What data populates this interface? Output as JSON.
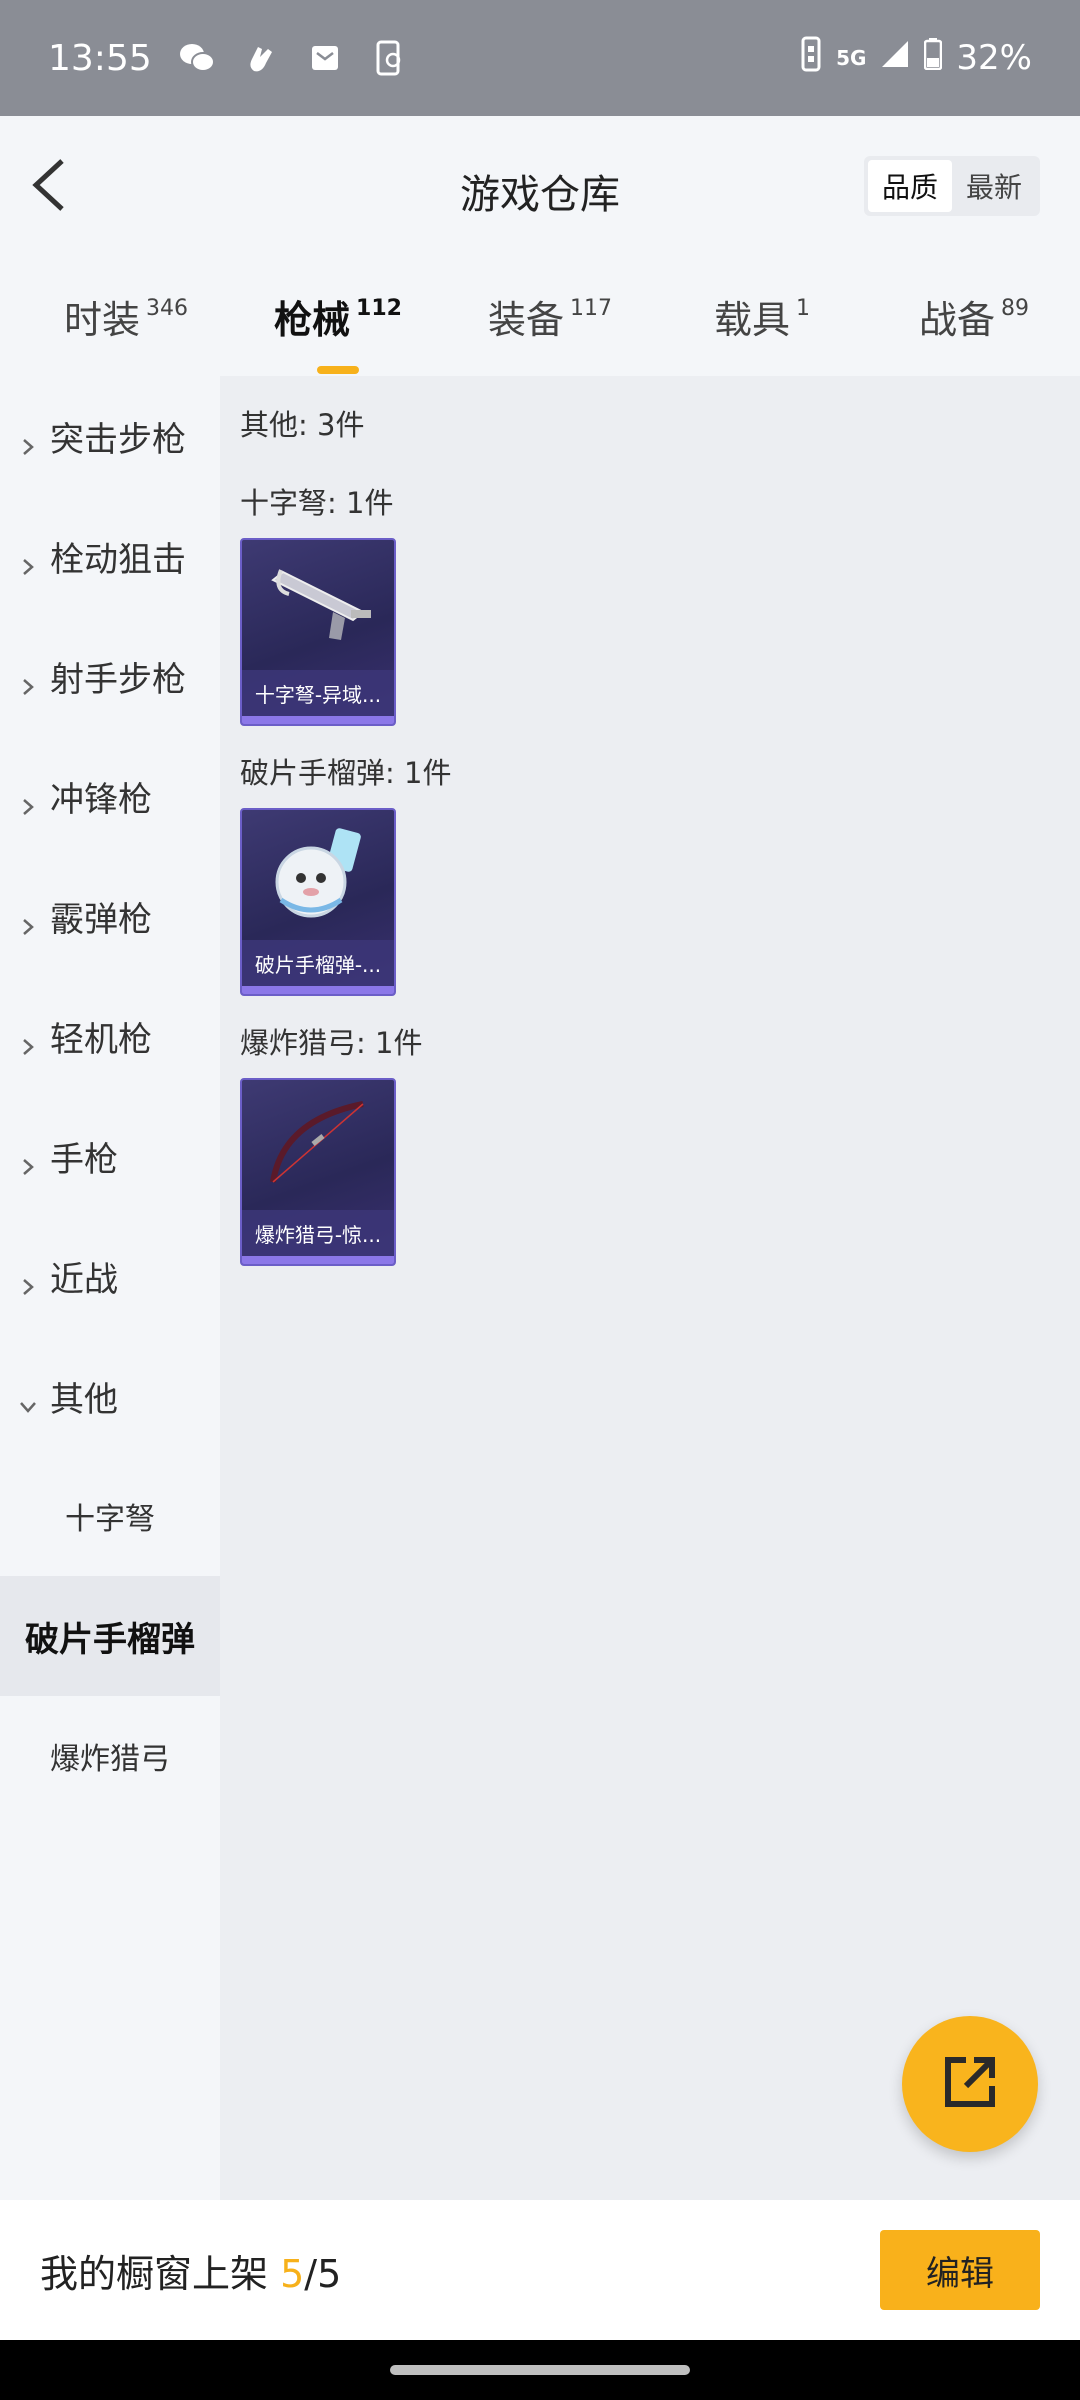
{
  "status_bar": {
    "time": "13:55",
    "network": "5G",
    "battery": "32%"
  },
  "header": {
    "title": "游戏仓库",
    "sort_options": [
      {
        "label": "品质",
        "active": true
      },
      {
        "label": "最新",
        "active": false
      }
    ]
  },
  "tabs": [
    {
      "label": "时装",
      "count": "346",
      "active": false
    },
    {
      "label": "枪械",
      "count": "112",
      "active": true
    },
    {
      "label": "装备",
      "count": "117",
      "active": false
    },
    {
      "label": "载具",
      "count": "1",
      "active": false
    },
    {
      "label": "战备",
      "count": "89",
      "active": false
    }
  ],
  "sidebar": {
    "items": [
      {
        "label": "突击步枪",
        "expanded": false
      },
      {
        "label": "栓动狙击",
        "expanded": false
      },
      {
        "label": "射手步枪",
        "expanded": false
      },
      {
        "label": "冲锋枪",
        "expanded": false
      },
      {
        "label": "霰弹枪",
        "expanded": false
      },
      {
        "label": "轻机枪",
        "expanded": false
      },
      {
        "label": "手枪",
        "expanded": false
      },
      {
        "label": "近战",
        "expanded": false
      },
      {
        "label": "其他",
        "expanded": true
      }
    ],
    "sub_items": [
      {
        "label": "十字弩",
        "active": false
      },
      {
        "label": "破片手榴弹",
        "active": true
      },
      {
        "label": "爆炸猎弓",
        "active": false
      }
    ]
  },
  "main": {
    "summary": "其他: 3件",
    "groups": [
      {
        "title": "十字弩: 1件",
        "card_label": "十字弩-异域...",
        "art": "crossbow"
      },
      {
        "title": "破片手榴弹: 1件",
        "card_label": "破片手榴弹-...",
        "art": "grenade"
      },
      {
        "title": "爆炸猎弓: 1件",
        "card_label": "爆炸猎弓-惊...",
        "art": "bow"
      }
    ]
  },
  "bottom_bar": {
    "prefix": "我的橱窗上架 ",
    "count": "5",
    "total": "/5",
    "edit_label": "编辑"
  },
  "colors": {
    "accent": "#f9b11b",
    "card_bg": "#2a2858",
    "card_border": "#6b5ec7"
  }
}
